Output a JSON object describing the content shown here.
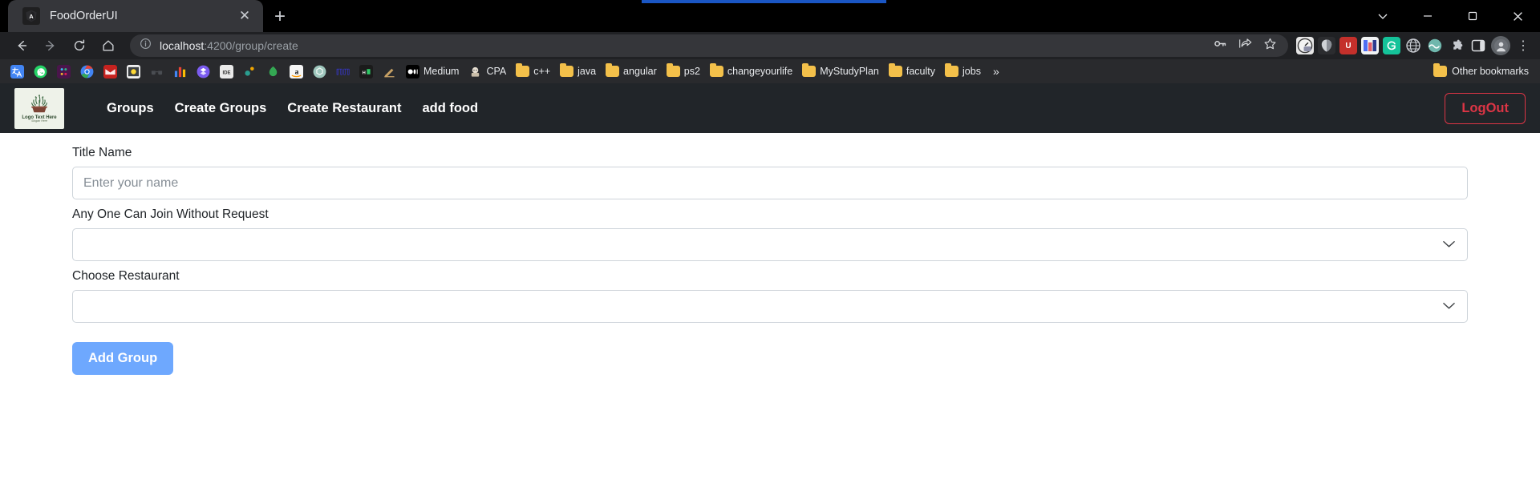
{
  "browser": {
    "tab": {
      "title": "FoodOrderUI",
      "favicon_icon": "angular-icon",
      "close_icon": "close-icon"
    },
    "new_tab_icon": "plus-icon",
    "window_controls": [
      {
        "name": "chevron-down-icon",
        "glyph": "⌄"
      },
      {
        "name": "minimize-icon",
        "glyph": "─"
      },
      {
        "name": "maximize-icon",
        "glyph": "☐"
      },
      {
        "name": "close-icon",
        "glyph": "✕"
      }
    ],
    "nav": {
      "back_icon": "back-arrow-icon",
      "forward_icon": "forward-arrow-icon",
      "reload_icon": "reload-icon",
      "home_icon": "home-icon"
    },
    "omnibox": {
      "info_icon": "site-info-icon",
      "url_host": "localhost",
      "url_path": ":4200/group/create",
      "actions": [
        {
          "name": "password-key-icon",
          "glyph": "⚷"
        },
        {
          "name": "share-icon",
          "glyph": "↪"
        },
        {
          "name": "bookmark-star-icon",
          "glyph": "☆"
        }
      ]
    },
    "extensions": [
      {
        "name": "speedtest-extension-icon",
        "label": "",
        "color": "#dcdcdc"
      },
      {
        "name": "ghostery-extension-icon",
        "label": "",
        "color": "#9aa0a6"
      },
      {
        "name": "udemy-extension-icon",
        "label": "U",
        "color": "#c4302b"
      },
      {
        "name": "grid-extension-icon",
        "label": "",
        "color": "#4e6ef2"
      },
      {
        "name": "grammarly-extension-icon",
        "label": "G",
        "color": "#15c39a"
      },
      {
        "name": "globe-extension-icon",
        "label": "",
        "color": "#7a7f87"
      },
      {
        "name": "wave-extension-icon",
        "label": "",
        "color": "#5ab4ac"
      },
      {
        "name": "puzzle-extensions-icon",
        "label": "",
        "color": "#9aa0a6"
      },
      {
        "name": "sidepanel-icon",
        "label": "",
        "color": "#c7cad0"
      }
    ],
    "profile_icon": "profile-avatar-icon",
    "menu_icon": "kebab-menu-icon",
    "bookmarks": [
      {
        "label": "",
        "icon": "translate-icon",
        "color": "#4285f4",
        "type": "site"
      },
      {
        "label": "",
        "icon": "whatsapp-icon",
        "color": "#25d366",
        "type": "site"
      },
      {
        "label": "",
        "icon": "slack-icon",
        "color": "#4a154b",
        "type": "site"
      },
      {
        "label": "",
        "icon": "chrome-icon",
        "color": "#4285f4",
        "type": "site"
      },
      {
        "label": "",
        "icon": "gmail-icon",
        "color": "#d93025",
        "type": "site"
      },
      {
        "label": "",
        "icon": "notes-icon",
        "color": "#f0f0f0",
        "type": "site"
      },
      {
        "label": "",
        "icon": "sunglasses-icon",
        "color": "#3c4043",
        "type": "site"
      },
      {
        "label": "",
        "icon": "chart-icon",
        "color": "#e8eaed",
        "type": "site"
      },
      {
        "label": "",
        "icon": "dropbox-icon",
        "color": "#8a4fff",
        "type": "site"
      },
      {
        "label": "",
        "icon": "ide-one-icon",
        "color": "#e8eaed",
        "type": "site"
      },
      {
        "label": "",
        "icon": "sparkle-icon",
        "color": "#f0a500",
        "type": "site"
      },
      {
        "label": "",
        "icon": "leaf-icon",
        "color": "#34a853",
        "type": "site"
      },
      {
        "label": "",
        "icon": "amazon-icon",
        "color": "#f2f2f2",
        "type": "site"
      },
      {
        "label": "",
        "icon": "openai-icon",
        "color": "#9ec7bd",
        "type": "site"
      },
      {
        "label": "",
        "icon": "nn-icon",
        "color": "#3b3bff",
        "type": "site"
      },
      {
        "label": "",
        "icon": "hackerrank-icon",
        "color": "#1d1d1d",
        "type": "site"
      },
      {
        "label": "",
        "icon": "pen-icon",
        "color": "#c8a165",
        "type": "site"
      },
      {
        "label": "Medium",
        "icon": "medium-icon",
        "color": "#000000",
        "type": "site"
      },
      {
        "label": "CPA",
        "icon": "judge-icon",
        "color": "#d9d2c5",
        "type": "site"
      },
      {
        "label": "c++",
        "icon": "folder-icon",
        "type": "folder"
      },
      {
        "label": "java",
        "icon": "folder-icon",
        "type": "folder"
      },
      {
        "label": "angular",
        "icon": "folder-icon",
        "type": "folder"
      },
      {
        "label": "ps2",
        "icon": "folder-icon",
        "type": "folder"
      },
      {
        "label": "changeyourlife",
        "icon": "folder-icon",
        "type": "folder"
      },
      {
        "label": "MyStudyPlan",
        "icon": "folder-icon",
        "type": "folder"
      },
      {
        "label": "faculty",
        "icon": "folder-icon",
        "type": "folder"
      },
      {
        "label": "jobs",
        "icon": "folder-icon",
        "type": "folder"
      }
    ],
    "bookmarks_overflow_icon": "chevron-double-right-icon",
    "bookmarks_overflow_label": "»",
    "other_bookmarks": {
      "label": "Other bookmarks",
      "icon": "folder-icon"
    }
  },
  "app": {
    "logo": {
      "name": "plant-logo",
      "text": "Logo Text Here",
      "subtext": "Slogan Here"
    },
    "nav_links": [
      {
        "label": "Groups",
        "name": "nav-groups"
      },
      {
        "label": "Create Groups",
        "name": "nav-create-groups"
      },
      {
        "label": "Create Restaurant",
        "name": "nav-create-restaurant"
      },
      {
        "label": "add food",
        "name": "nav-add-food"
      }
    ],
    "logout_label": "LogOut",
    "accent_color": "#dc3545",
    "navbar_color": "#212529",
    "primary_button_color": "#6ea8fe",
    "form": {
      "title_field": {
        "label": "Title Name",
        "placeholder": "Enter your name",
        "value": ""
      },
      "join_field": {
        "label": "Any One Can Join Without Request",
        "value": "",
        "chevron_icon": "chevron-down-icon"
      },
      "restaurant_field": {
        "label": "Choose Restaurant",
        "value": "",
        "chevron_icon": "chevron-down-icon"
      },
      "submit_label": "Add Group"
    }
  }
}
